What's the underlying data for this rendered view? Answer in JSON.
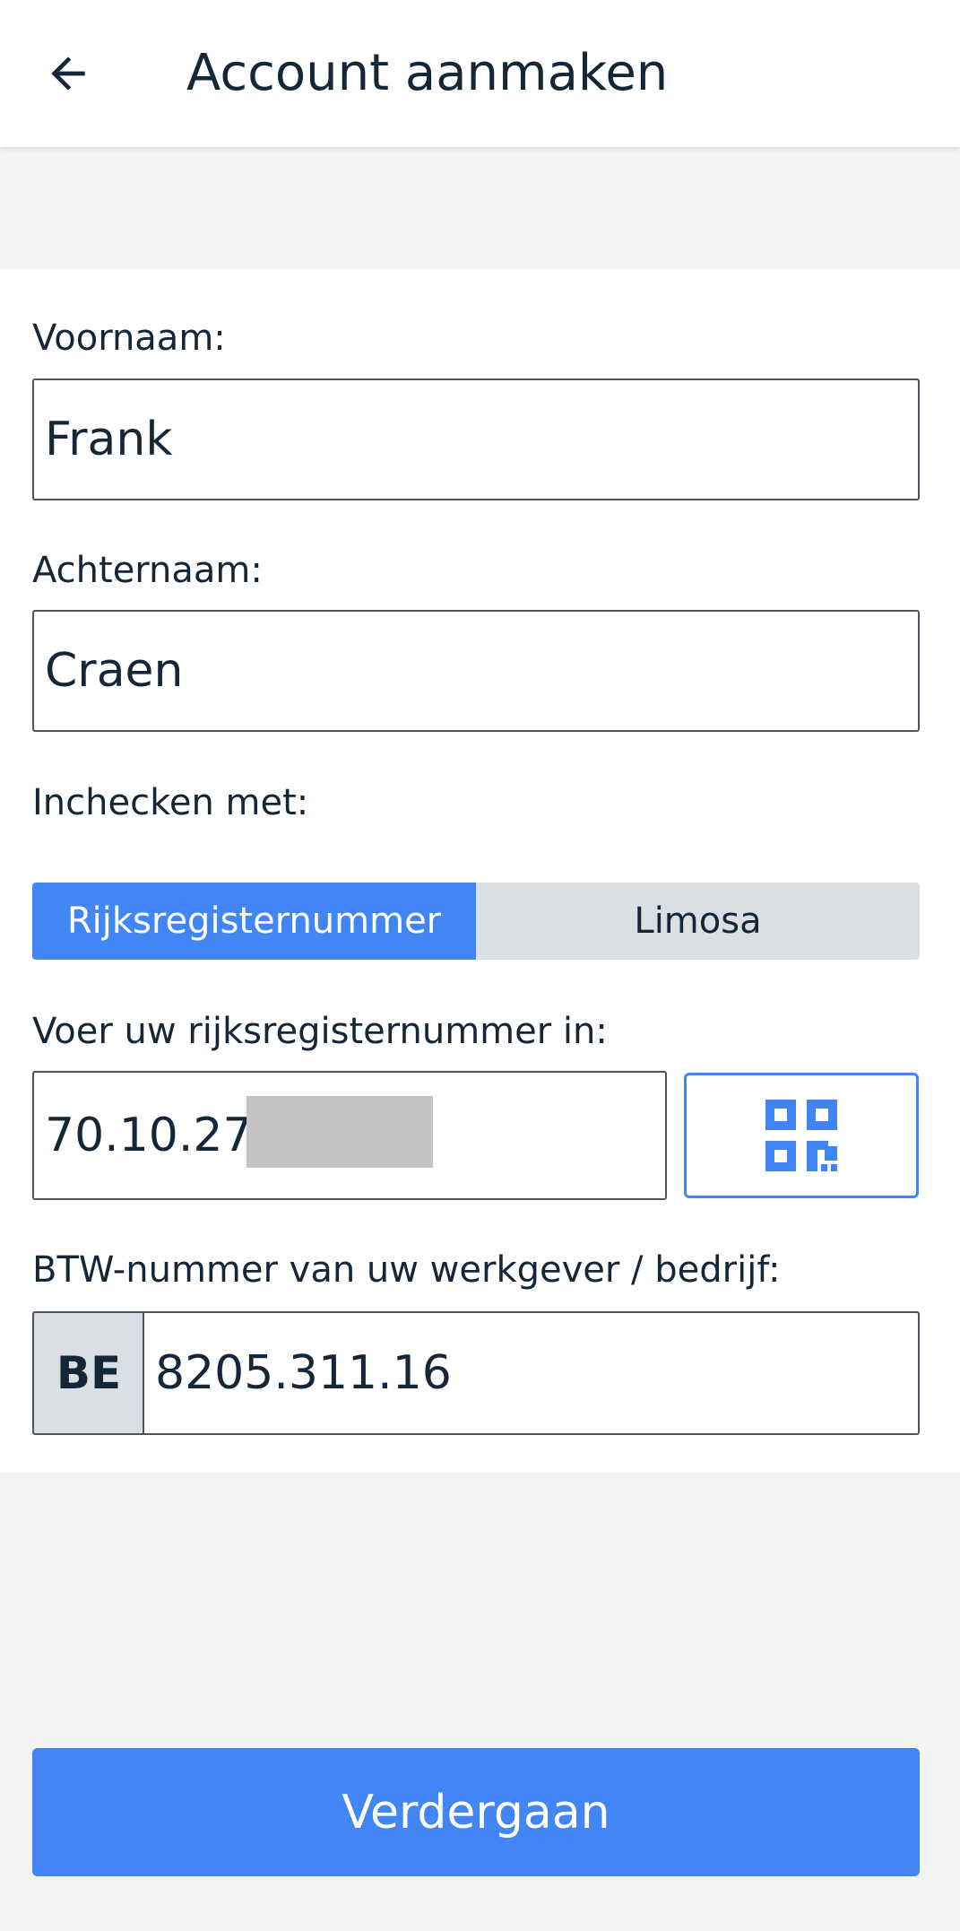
{
  "header": {
    "title": "Account aanmaken",
    "back_icon": "arrow-left-icon"
  },
  "form": {
    "first_name": {
      "label": "Voornaam:",
      "value": "Frank"
    },
    "last_name": {
      "label": "Achternaam:",
      "value": "Craen"
    },
    "checkin_method": {
      "label": "Inchecken met:",
      "options": [
        "Rijksregisternummer",
        "Limosa"
      ],
      "selected": "Rijksregisternummer"
    },
    "national_number": {
      "label": "Voer uw rijksregisternummer in:",
      "value": "70.10.27-",
      "scan_icon": "qr-code-icon"
    },
    "vat_number": {
      "label": "BTW-nummer van uw werkgever / bedrijf:",
      "prefix": "BE",
      "value": "8205.311.16"
    }
  },
  "actions": {
    "continue_label": "Verdergaan"
  },
  "colors": {
    "accent": "#4285f4",
    "text": "#142638",
    "segment_inactive": "#dadfe4",
    "background": "#f2f3f3"
  }
}
